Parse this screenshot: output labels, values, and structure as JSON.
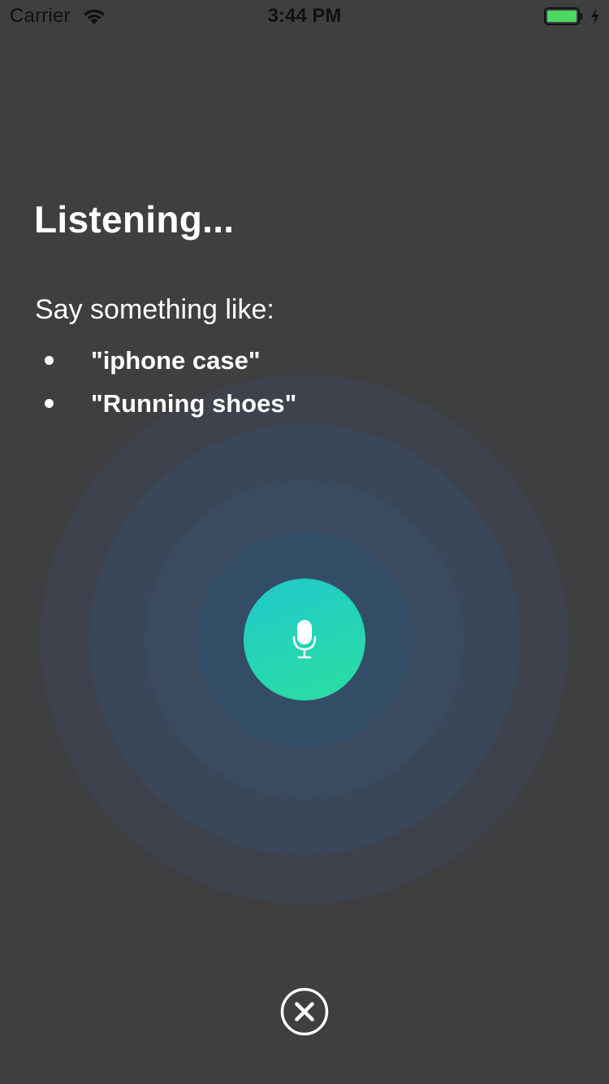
{
  "status_bar": {
    "carrier": "Carrier",
    "time": "3:44 PM",
    "battery_color": "#4cd964"
  },
  "main": {
    "title": "Listening...",
    "prompt": "Say something like:",
    "suggestions": [
      {
        "label": "\"iphone case\""
      },
      {
        "label": "\"Running shoes\""
      }
    ]
  },
  "colors": {
    "background": "#3f3f41",
    "mic_gradient_start": "#20c9cc",
    "mic_gradient_end": "#2adfa0"
  },
  "icons": {
    "mic": "microphone-icon",
    "close": "close-circle-icon"
  }
}
